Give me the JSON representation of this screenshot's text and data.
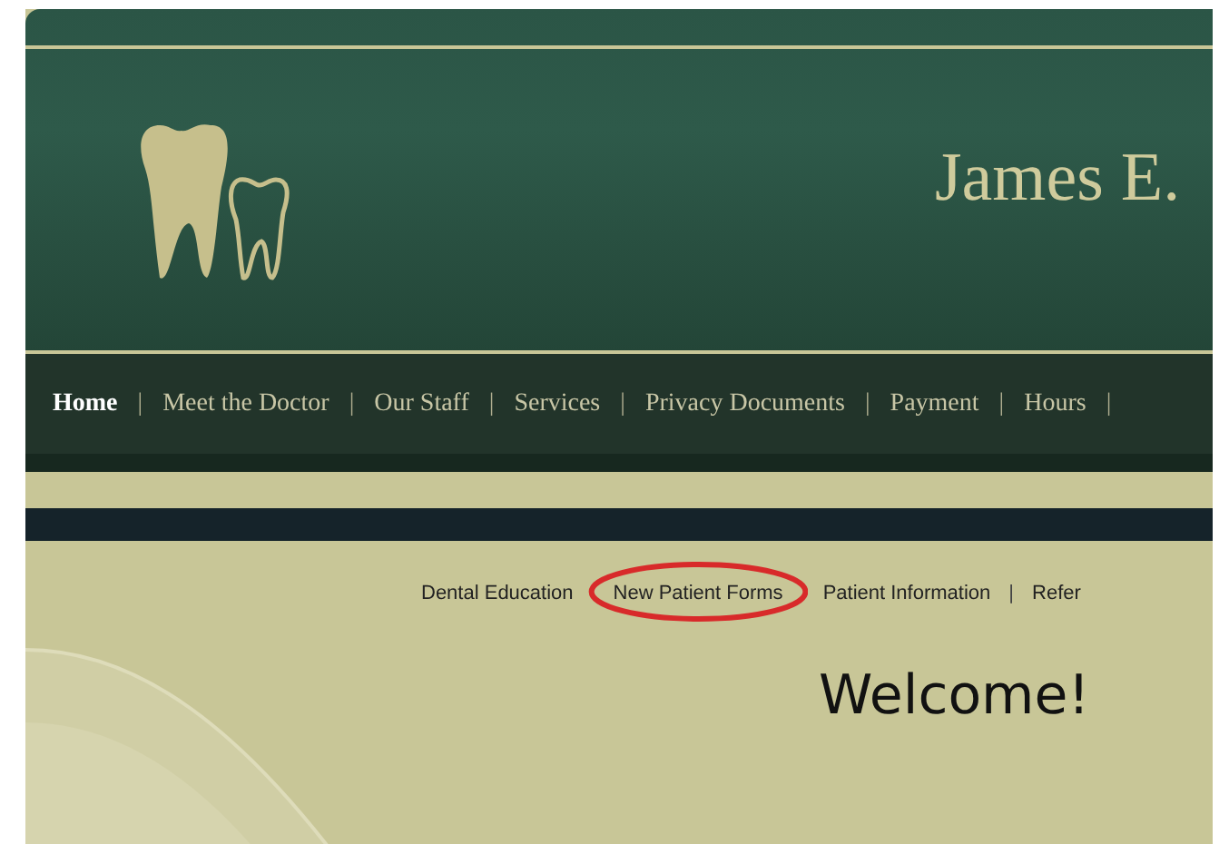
{
  "header": {
    "title": "James E."
  },
  "main_nav": [
    {
      "label": "Home",
      "selected": true
    },
    {
      "label": "Meet the Doctor",
      "selected": false
    },
    {
      "label": "Our Staff",
      "selected": false
    },
    {
      "label": "Services",
      "selected": false
    },
    {
      "label": "Privacy Documents",
      "selected": false
    },
    {
      "label": "Payment",
      "selected": false
    },
    {
      "label": "Hours",
      "selected": false
    }
  ],
  "main_nav_separator": "|",
  "sub_nav": [
    {
      "label": "Dental Education",
      "circled": false
    },
    {
      "label": "New Patient Forms",
      "circled": true
    },
    {
      "label": "Patient Information",
      "circled": false
    },
    {
      "label": "Refer",
      "circled": false
    }
  ],
  "sub_nav_separator": "|",
  "heading": "Welcome!"
}
